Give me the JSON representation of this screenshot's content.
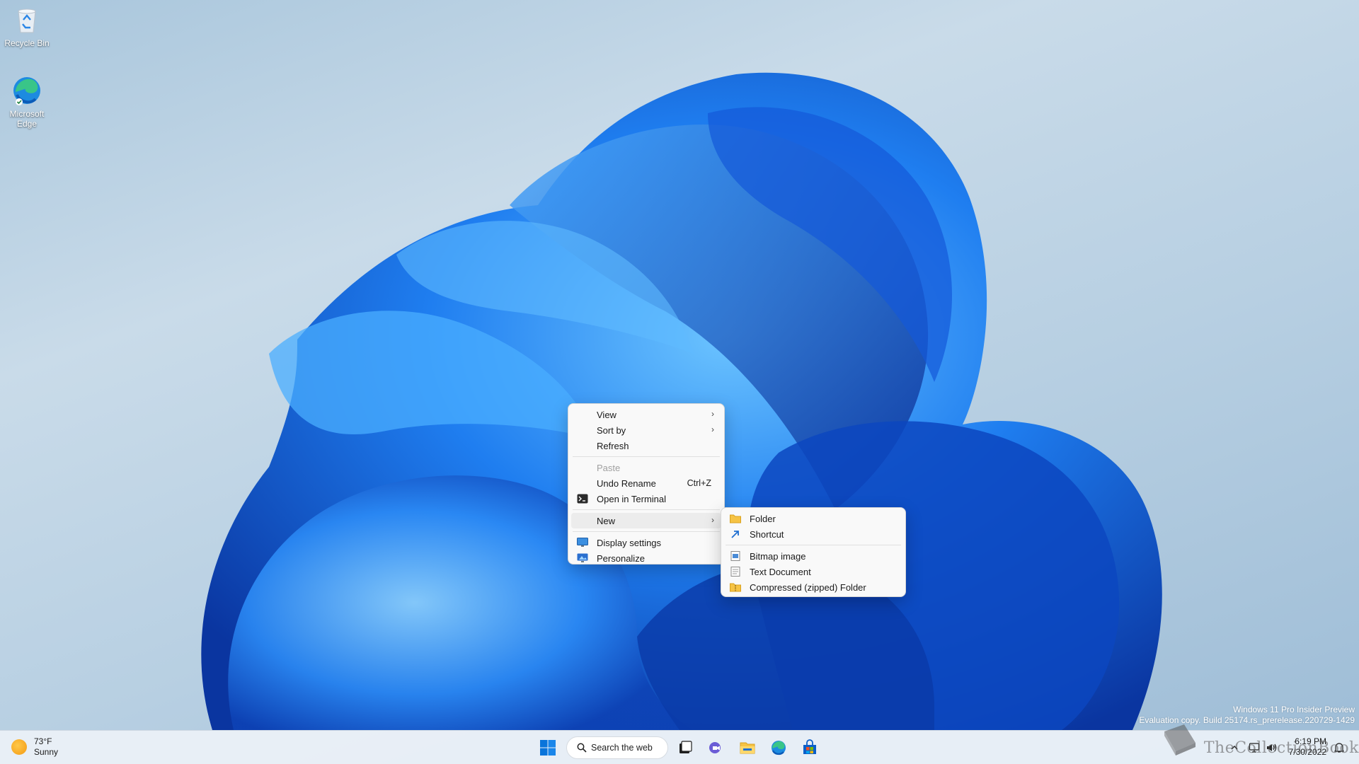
{
  "desktop": {
    "icons": [
      {
        "label": "Recycle Bin",
        "icon": "recycle-bin-icon"
      },
      {
        "label": "Microsoft Edge",
        "icon": "edge-icon"
      }
    ]
  },
  "context_menu": {
    "items": {
      "view": "View",
      "sort_by": "Sort by",
      "refresh": "Refresh",
      "paste": "Paste",
      "undo_rename": "Undo Rename",
      "undo_rename_shortcut": "Ctrl+Z",
      "open_in_terminal": "Open in Terminal",
      "new": "New",
      "display_settings": "Display settings",
      "personalize": "Personalize"
    }
  },
  "new_submenu": {
    "items": {
      "folder": "Folder",
      "shortcut": "Shortcut",
      "bitmap_image": "Bitmap image",
      "text_document": "Text Document",
      "compressed_folder": "Compressed (zipped) Folder"
    }
  },
  "watermark": {
    "line1": "Windows 11 Pro Insider Preview",
    "line2": "Evaluation copy. Build 25174.rs_prerelease.220729-1429"
  },
  "taskbar": {
    "weather": {
      "temp": "73°F",
      "condition": "Sunny"
    },
    "search_label": "Search the web",
    "clock": {
      "time": "6:19 PM",
      "date": "7/30/2022"
    },
    "watermark_text": "TheCollectionBook"
  },
  "colors": {
    "accent": "#0067c0",
    "bloom_dark": "#0a3aa8",
    "bloom_light": "#3aa0ff"
  }
}
